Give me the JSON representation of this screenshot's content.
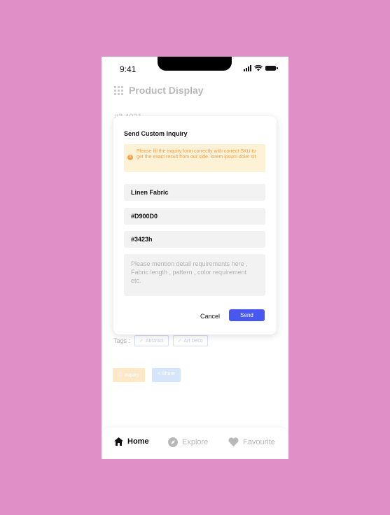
{
  "status_bar": {
    "time": "9:41"
  },
  "header": {
    "title": "Product Display"
  },
  "background": {
    "sku_partial": "#3 4921",
    "tags_label": "Tags :",
    "tags": [
      "Abstract",
      "Art Deco"
    ],
    "inquiry_label": "Inquiry",
    "share_label": "Share"
  },
  "modal": {
    "title": "Send Custom Inquiry",
    "alert": "Please fill the inquiry form correctly with correct SKU to get the exact result from our side. lorem ipsum doler sit",
    "fields": {
      "fabric": "Linen Fabric",
      "color_code": "#D900D0",
      "sku": "#3423h"
    },
    "requirements_placeholder": "Please mention detail requirements here , Fabric length , pattern , color requirement etc.",
    "cancel_label": "Cancel",
    "send_label": "Send"
  },
  "bottom_nav": {
    "home": "Home",
    "explore": "Explore",
    "favourite": "Favourite"
  },
  "colors": {
    "page_bg": "#e18fc7",
    "accent": "#4758f0",
    "alert_bg": "#fdf1d6",
    "alert_text": "#f3a049"
  }
}
